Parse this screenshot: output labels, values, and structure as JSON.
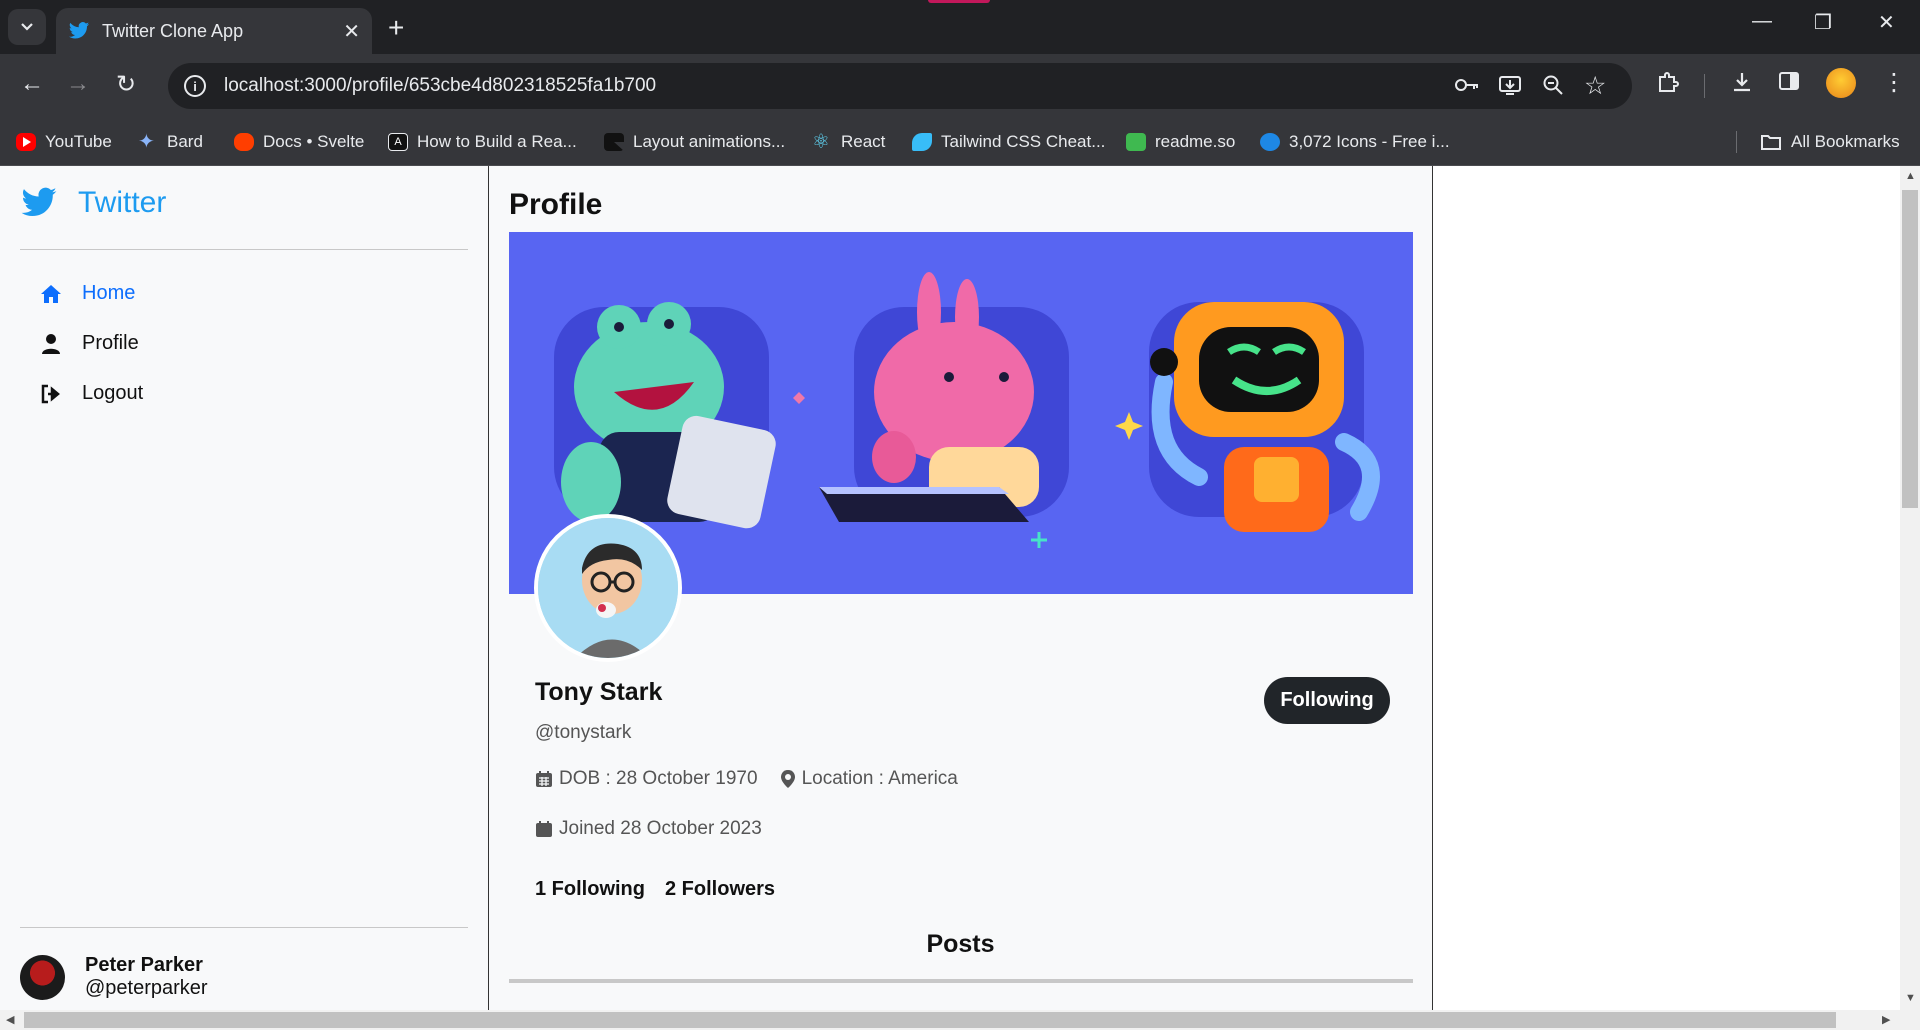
{
  "browser": {
    "tab_title": "Twitter Clone App",
    "url": "localhost:3000/profile/653cbe4d802318525fa1b700",
    "bookmarks": [
      {
        "label": "YouTube",
        "icon": "youtube-icon",
        "color": "#ff0000"
      },
      {
        "label": "Bard",
        "icon": "bard-sparkle-icon",
        "color": "#8ab4f8"
      },
      {
        "label": "Docs • Svelte",
        "icon": "svelte-icon",
        "color": "#ff3e00"
      },
      {
        "label": "How to Build a Rea...",
        "icon": "astro-icon",
        "color": "#ffffff"
      },
      {
        "label": "Layout animations...",
        "icon": "framer-icon",
        "color": "#111111"
      },
      {
        "label": "React",
        "icon": "react-icon",
        "color": "#61dafb"
      },
      {
        "label": "Tailwind CSS Cheat...",
        "icon": "tailwind-leaf-icon",
        "color": "#38bdf8"
      },
      {
        "label": "readme.so",
        "icon": "readme-icon",
        "color": "#3fb950"
      },
      {
        "label": "3,072 Icons - Free i...",
        "icon": "icons-search-icon",
        "color": "#1e88e5"
      }
    ],
    "all_bookmarks_label": "All Bookmarks"
  },
  "sidebar": {
    "brand": "Twitter",
    "menu": [
      {
        "label": "Home",
        "icon": "home-icon"
      },
      {
        "label": "Profile",
        "icon": "user-icon"
      },
      {
        "label": "Logout",
        "icon": "logout-icon"
      }
    ],
    "current_user": {
      "name": "Peter Parker",
      "handle": "@peterparker"
    }
  },
  "main": {
    "title": "Profile",
    "profile": {
      "name": "Tony Stark",
      "handle": "@tonystark",
      "dob": "DOB : 28 October 1970",
      "location": "Location : America",
      "joined": "Joined 28 October 2023",
      "following": "1 Following",
      "followers": "2 Followers",
      "follow_button": "Following"
    },
    "posts_heading": "Posts"
  },
  "colors": {
    "banner": "#5865f2",
    "brand_blue": "#1d9bf0",
    "active_link": "#0d6efd",
    "button_dark": "#212529"
  }
}
